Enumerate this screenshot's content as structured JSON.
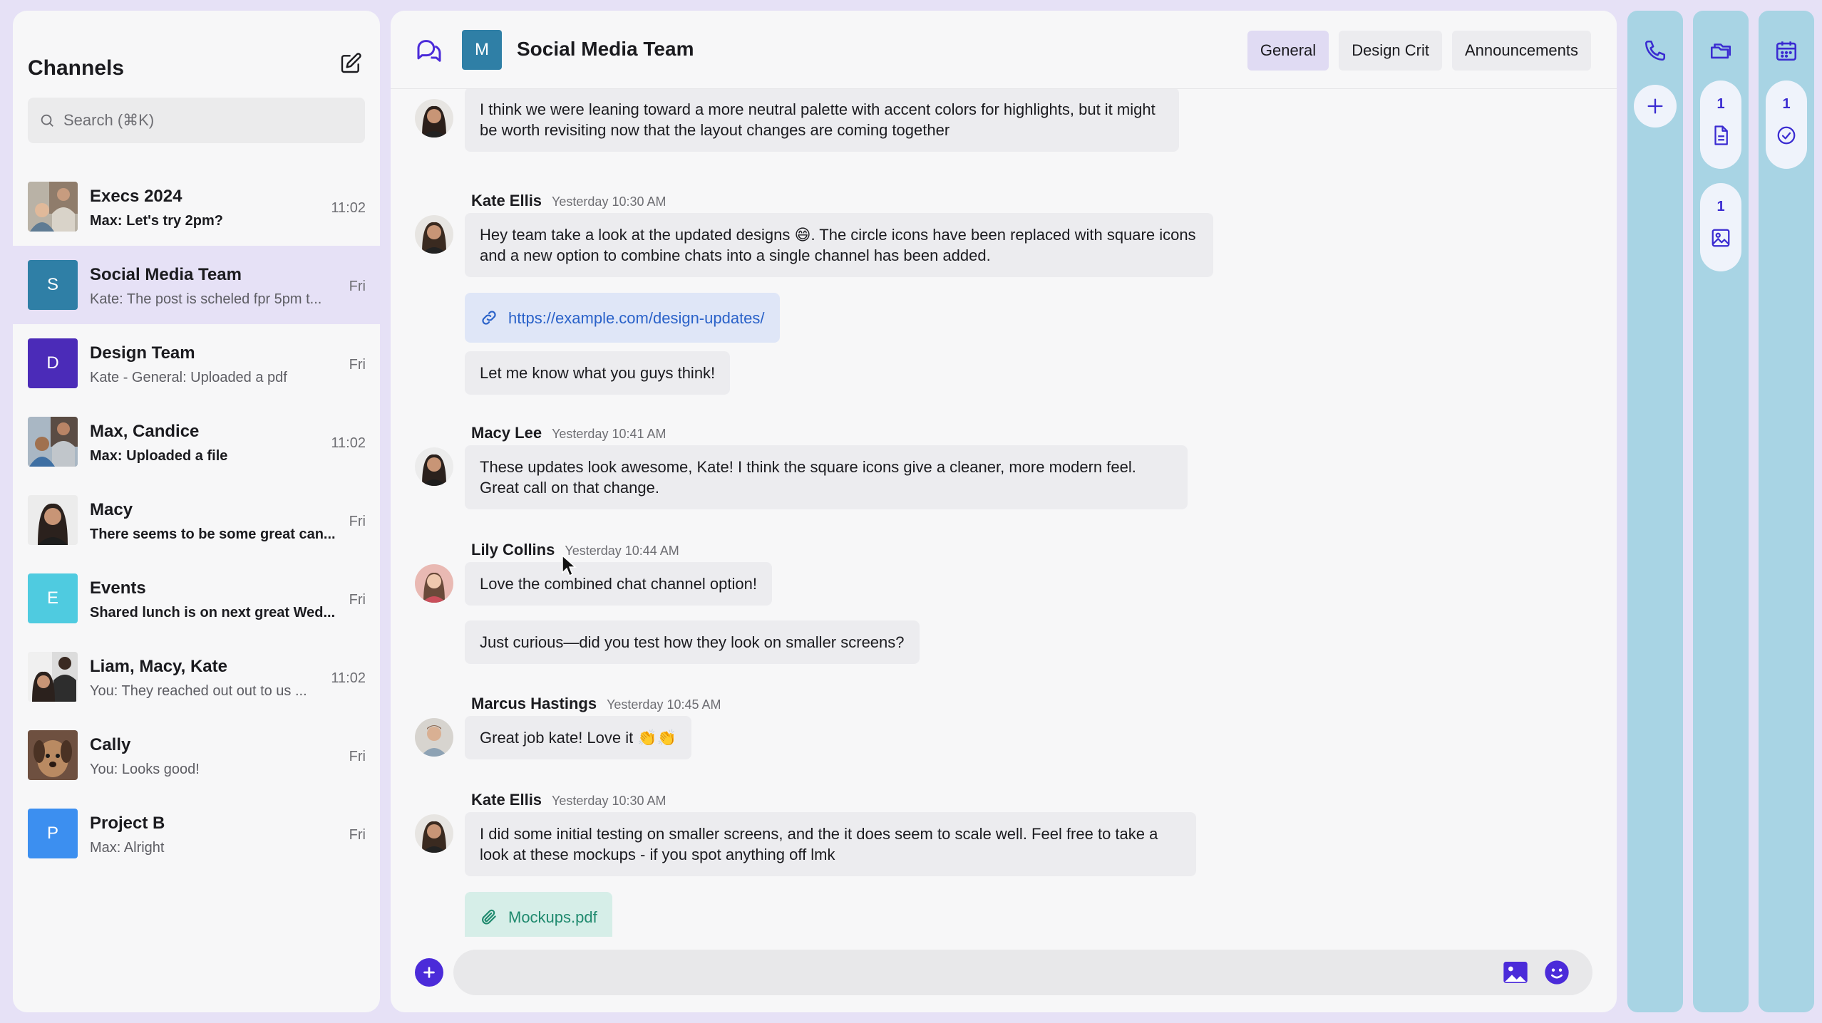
{
  "sidebar": {
    "title": "Channels",
    "search_placeholder": "Search (⌘K)",
    "channels": [
      {
        "name": "Execs 2024",
        "preview": "Max: Let's try 2pm?",
        "time": "11:02",
        "unread": true,
        "avatar": "photo-group"
      },
      {
        "name": "Social Media Team",
        "preview": "Kate: The post is scheled fpr 5pm t...",
        "time": "Fri",
        "unread": false,
        "avatar_letter": "S",
        "avatar_color": "#2f7fa6",
        "active": true
      },
      {
        "name": "Design Team",
        "preview": "Kate - General: Uploaded a pdf",
        "time": "Fri",
        "unread": false,
        "avatar_letter": "D",
        "avatar_color": "#4b2bb8"
      },
      {
        "name": "Max, Candice",
        "preview": "Max: Uploaded a file",
        "time": "11:02",
        "unread": true,
        "avatar": "photo-pair"
      },
      {
        "name": "Macy",
        "preview": "There seems to be some great can...",
        "time": "Fri",
        "unread": true,
        "avatar": "photo-single"
      },
      {
        "name": "Events",
        "preview": "Shared lunch is on next great Wed...",
        "time": "Fri",
        "unread": true,
        "avatar_letter": "E",
        "avatar_color": "#4fcbe0"
      },
      {
        "name": "Liam, Macy, Kate",
        "preview": "You: They reached out out to us ...",
        "time": "11:02",
        "unread": false,
        "avatar": "photo-pair"
      },
      {
        "name": "Cally",
        "preview": "You: Looks good!",
        "time": "Fri",
        "unread": false,
        "avatar": "photo-dog"
      },
      {
        "name": "Project B",
        "preview": "Max: Alright",
        "time": "Fri",
        "unread": false,
        "avatar_letter": "P",
        "avatar_color": "#3c8ff0"
      }
    ]
  },
  "main": {
    "team_avatar_letter": "M",
    "team_name": "Social Media Team",
    "tabs": [
      "General",
      "Design Crit",
      "Announcements"
    ],
    "active_tab": "General",
    "messages": {
      "m0_text": "I think we were leaning toward a more neutral palette with accent colors for highlights, but it might be worth revisiting now that the layout changes are coming together",
      "m1_author": "Kate Ellis",
      "m1_time": "Yesterday 10:30 AM",
      "m1_text": "Hey team take a look at the updated designs 😄. The circle icons have been replaced with square icons and a new option to combine chats into a single channel has been added.",
      "m1_link": "https://example.com/design-updates/",
      "m1_text2": "Let me know what you guys think!",
      "m2_author": "Macy Lee",
      "m2_time": "Yesterday 10:41 AM",
      "m2_text": "These updates look awesome, Kate! I think the square icons give a cleaner, more modern feel. Great call on that change.",
      "m3_author": "Lily Collins",
      "m3_time": "Yesterday 10:44 AM",
      "m3_text": "Love the combined chat channel option!",
      "m3_text2": "Just curious—did you test how they look on smaller screens?",
      "m4_author": "Marcus Hastings",
      "m4_time": "Yesterday 10:45 AM",
      "m4_text": "Great job kate! Love it 👏👏",
      "m5_author": "Kate Ellis",
      "m5_time": "Yesterday 10:30 AM",
      "m5_text": "I did some initial testing on smaller screens, and the it does seem to scale well. Feel free to take a look at these mockups - if you spot anything off lmk",
      "m5_file": "Mockups.pdf"
    },
    "composer_placeholder": ""
  },
  "rails": {
    "files_count": "1",
    "images_count": "1",
    "tasks_count": "1"
  },
  "colors": {
    "accent": "#4b2bd9",
    "rail": "#a8d4e4",
    "active_item": "#e6e1f6"
  }
}
